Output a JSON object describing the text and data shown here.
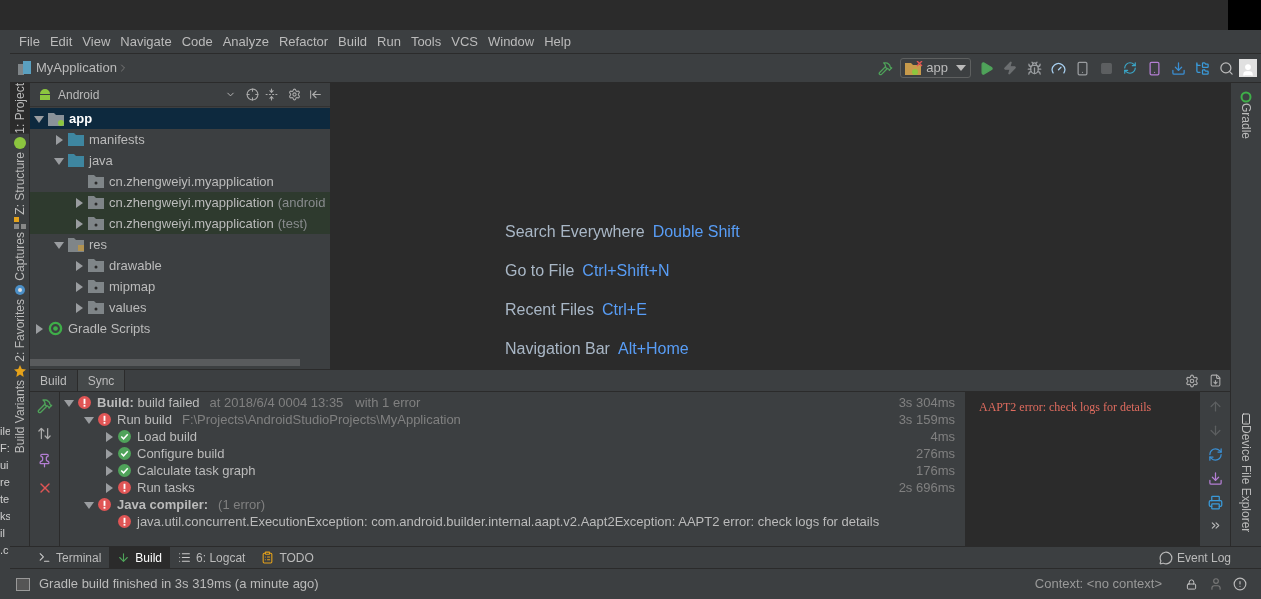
{
  "background_window": {
    "fragments": [
      "ile",
      "F:",
      "ui",
      "re",
      "te",
      "ks",
      "il",
      ".c"
    ]
  },
  "menu": [
    "File",
    "Edit",
    "View",
    "Navigate",
    "Code",
    "Analyze",
    "Refactor",
    "Build",
    "Run",
    "Tools",
    "VCS",
    "Window",
    "Help"
  ],
  "breadcrumb": "MyApplication",
  "run_config": "app",
  "left_strip": [
    {
      "label": "1: Project",
      "selected": true
    },
    {
      "label": "Z: Structure",
      "selected": false
    },
    {
      "label": "Captures",
      "selected": false
    },
    {
      "label": "2: Favorites",
      "selected": false
    },
    {
      "label": "Build Variants",
      "selected": false
    }
  ],
  "right_strip": [
    "Gradle",
    "Device File Explorer"
  ],
  "project": {
    "view": "Android",
    "tree": [
      {
        "label": "app",
        "kind": "module",
        "expandable": true,
        "expanded": true,
        "selected": true,
        "highlighted": false,
        "children": [
          {
            "label": "manifests",
            "kind": "folder",
            "expandable": true,
            "expanded": false,
            "selected": false,
            "highlighted": false
          },
          {
            "label": "java",
            "kind": "folder",
            "expandable": true,
            "expanded": true,
            "selected": false,
            "highlighted": false,
            "children": [
              {
                "label": "cn.zhengweiyi.myapplication",
                "kind": "package",
                "expandable": false,
                "expanded": false,
                "selected": false,
                "highlighted": false
              },
              {
                "label": "cn.zhengweiyi.myapplication",
                "suffix": "(android",
                "kind": "package",
                "expandable": true,
                "expanded": false,
                "selected": false,
                "highlighted": true
              },
              {
                "label": "cn.zhengweiyi.myapplication",
                "suffix": "(test)",
                "kind": "package",
                "expandable": true,
                "expanded": false,
                "selected": false,
                "highlighted": true
              }
            ]
          },
          {
            "label": "res",
            "kind": "res",
            "expandable": true,
            "expanded": true,
            "selected": false,
            "highlighted": false,
            "children": [
              {
                "label": "drawable",
                "kind": "package",
                "expandable": true,
                "expanded": false,
                "selected": false,
                "highlighted": false
              },
              {
                "label": "mipmap",
                "kind": "package",
                "expandable": true,
                "expanded": false,
                "selected": false,
                "highlighted": false
              },
              {
                "label": "values",
                "kind": "package",
                "expandable": true,
                "expanded": false,
                "selected": false,
                "highlighted": false
              }
            ]
          }
        ]
      },
      {
        "label": "Gradle Scripts",
        "kind": "gradle",
        "expandable": true,
        "expanded": false,
        "selected": false,
        "highlighted": false
      }
    ]
  },
  "editor_hints": [
    {
      "action": "Search Everywhere",
      "shortcut": "Double Shift"
    },
    {
      "action": "Go to File",
      "shortcut": "Ctrl+Shift+N"
    },
    {
      "action": "Recent Files",
      "shortcut": "Ctrl+E"
    },
    {
      "action": "Navigation Bar",
      "shortcut": "Alt+Home"
    }
  ],
  "build": {
    "tabs": [
      {
        "label": "Build",
        "selected": false
      },
      {
        "label": "Sync",
        "selected": true
      }
    ],
    "tree": [
      {
        "text": "**Build:** build failed",
        "detail": "at 2018/6/4 0004 13:35",
        "extra": "with 1 error",
        "time": "3s 304ms",
        "failed": true,
        "expandable": true,
        "expanded": true,
        "children": [
          {
            "text": "Run build",
            "detail": "F:\\Projects\\AndroidStudioProjects\\MyApplication",
            "time": "3s 159ms",
            "failed": true,
            "expandable": true,
            "expanded": true,
            "children": [
              {
                "text": "Load build",
                "time": "4ms",
                "failed": false,
                "expandable": true,
                "expanded": false
              },
              {
                "text": "Configure build",
                "time": "276ms",
                "failed": false,
                "expandable": true,
                "expanded": false
              },
              {
                "text": "Calculate task graph",
                "time": "176ms",
                "failed": false,
                "expandable": true,
                "expanded": false
              },
              {
                "text": "Run tasks",
                "time": "2s 696ms",
                "failed": true,
                "expandable": true,
                "expanded": false
              }
            ]
          },
          {
            "text": "**Java compiler:**",
            "detail": "(1 error)",
            "failed": true,
            "expandable": true,
            "expanded": true,
            "children": [
              {
                "text": "java.util.concurrent.ExecutionException: com.android.builder.internal.aapt.v2.Aapt2Exception: AAPT2 error: check logs for details",
                "failed": true,
                "expandable": false,
                "expanded": false
              }
            ]
          }
        ]
      }
    ],
    "console": "AAPT2 error: check logs for details"
  },
  "bottom_tabs": [
    {
      "label": "Terminal",
      "kind": "terminal",
      "selected": false
    },
    {
      "label": "Build",
      "kind": "build",
      "selected": true
    },
    {
      "label": "6: Logcat",
      "kind": "logcat",
      "selected": false
    },
    {
      "label": "TODO",
      "kind": "todo",
      "selected": false
    }
  ],
  "event_log": "Event Log",
  "status": {
    "message": "Gradle build finished in 3s 319ms (a minute ago)",
    "context": "Context: <no context>"
  }
}
